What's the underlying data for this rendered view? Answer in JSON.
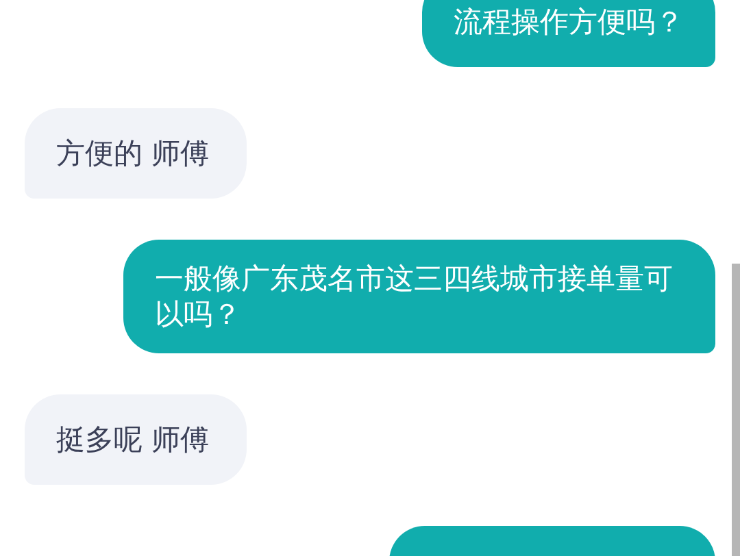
{
  "messages": [
    {
      "kind": "sent",
      "text": "流程操作方便吗？"
    },
    {
      "kind": "received",
      "text": "方便的 师傅"
    },
    {
      "kind": "sent",
      "text": "一般像广东茂名市这三四线城市接单量可以吗？"
    },
    {
      "kind": "received",
      "text": "挺多呢 师傅"
    },
    {
      "kind": "sent"
    }
  ]
}
